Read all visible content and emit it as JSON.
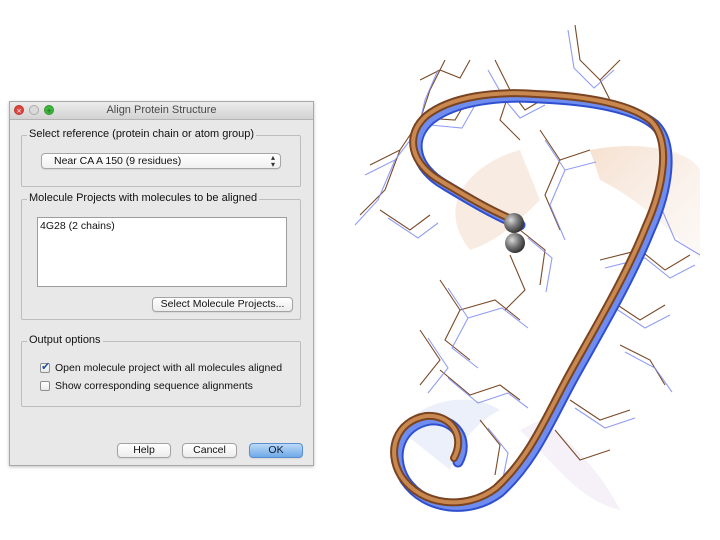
{
  "dialog": {
    "title": "Align Protein Structure",
    "window_controls": {
      "close_icon": "close-icon",
      "minimize_icon": "minimize-icon",
      "zoom_icon": "zoom-icon"
    }
  },
  "reference_group": {
    "label": "Select reference (protein chain or atom group)",
    "selected_value": "Near CA A 150 (9 residues)"
  },
  "projects_group": {
    "label": "Molecule Projects with molecules to be aligned",
    "items": [
      "4G28 (2 chains)"
    ],
    "select_button_label": "Select Molecule Projects..."
  },
  "output_group": {
    "label": "Output options",
    "options": [
      {
        "label": "Open molecule project with all molecules aligned",
        "checked": true
      },
      {
        "label": "Show corresponding sequence alignments",
        "checked": false
      }
    ]
  },
  "footer": {
    "help_label": "Help",
    "cancel_label": "Cancel",
    "ok_label": "OK"
  },
  "colors": {
    "ribbon_orange": "#b8743c",
    "ribbon_blue": "#5a78e0",
    "ok_blue": "#6fa9e8",
    "close_red": "#e0443e",
    "zoom_green": "#3fb83f"
  }
}
